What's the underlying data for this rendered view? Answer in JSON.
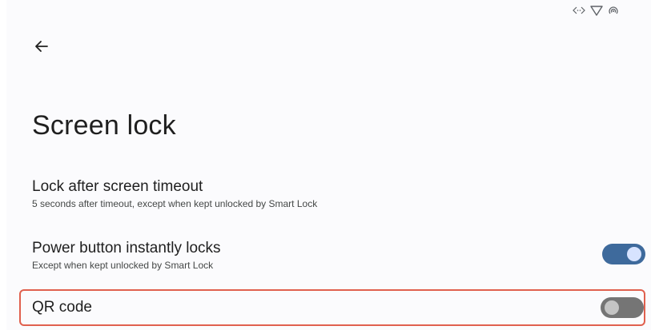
{
  "page": {
    "title": "Screen lock"
  },
  "settings": [
    {
      "title": "Lock after screen timeout",
      "summary": "5 seconds after timeout, except when kept unlocked by Smart Lock"
    },
    {
      "title": "Power button instantly locks",
      "summary": "Except when kept unlocked by Smart Lock",
      "toggle": "on"
    },
    {
      "title": "QR code",
      "toggle": "off"
    }
  ],
  "status_icons": [
    "data-arrows-icon",
    "wifi-icon",
    "hotspot-icon"
  ],
  "colors": {
    "toggle_on": "#3e6a9c",
    "toggle_off": "#757575",
    "highlight_border": "#e0604e"
  }
}
